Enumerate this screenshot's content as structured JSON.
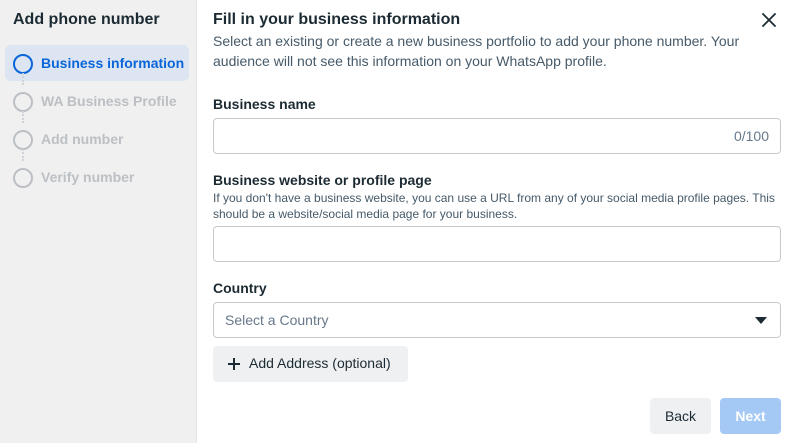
{
  "sidebar": {
    "title": "Add phone number",
    "steps": [
      {
        "label": "Business information",
        "active": true
      },
      {
        "label": "WA Business Profile",
        "active": false
      },
      {
        "label": "Add number",
        "active": false
      },
      {
        "label": "Verify number",
        "active": false
      }
    ]
  },
  "main": {
    "heading": "Fill in your business information",
    "subheading": "Select an existing or create a new business portfolio to add your phone number. Your audience will not see this information on your WhatsApp profile.",
    "business_name": {
      "label": "Business name",
      "value": "",
      "counter": "0/100"
    },
    "website": {
      "label": "Business website or profile page",
      "help": "If you don't have a business website, you can use a URL from any of your social media profile pages. This should be a website/social media page for your business.",
      "value": ""
    },
    "country": {
      "label": "Country",
      "placeholder": "Select a Country"
    },
    "add_address_label": "Add Address (optional)",
    "back_label": "Back",
    "next_label": "Next"
  },
  "colors": {
    "accent": "#0a66d8",
    "active_step_bg": "#dce5f1",
    "next_disabled": "#a4c9f5"
  },
  "icons": {
    "close": "close-icon",
    "plus": "plus-icon",
    "caret": "caret-down-icon",
    "step": "step-circle-icon"
  }
}
